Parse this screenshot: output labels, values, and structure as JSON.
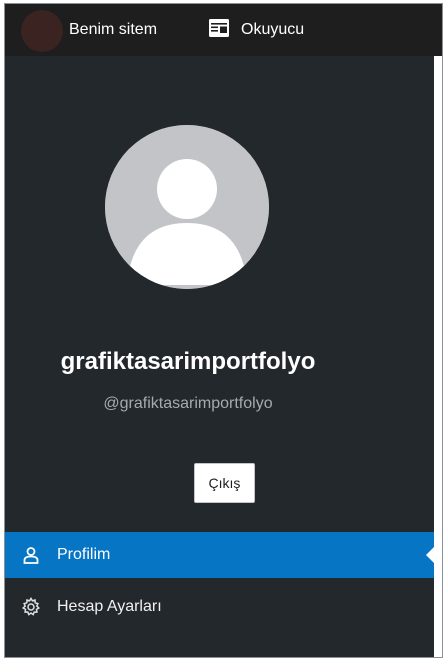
{
  "masterbar": {
    "site_label": "Benim sitem",
    "reader_label": "Okuyucu"
  },
  "profile": {
    "display_name": "grafiktasarimportfolyo",
    "handle": "@grafiktasarimportfolyo",
    "logout_label": "Çıkış"
  },
  "menu": {
    "items": [
      {
        "label": "Profilim",
        "icon": "person-icon",
        "active": true
      },
      {
        "label": "Hesap Ayarları",
        "icon": "gear-icon",
        "active": false
      }
    ]
  },
  "colors": {
    "masterbar_bg": "#1e1e1e",
    "sidebar_bg": "#23282d",
    "active_item_bg": "#0675c4",
    "avatar_placeholder": "#c3c4c7"
  }
}
